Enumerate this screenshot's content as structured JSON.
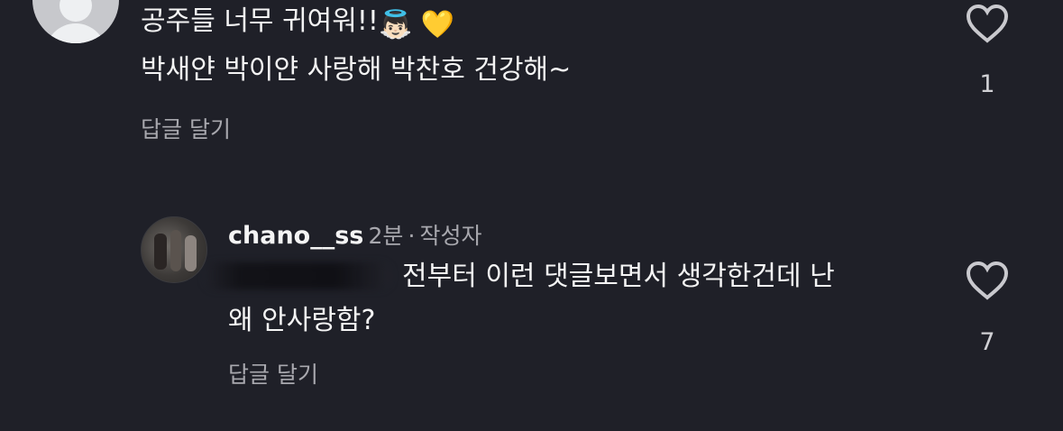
{
  "comment1": {
    "line1": "공주들 너무 귀여워!!",
    "emojis": [
      "👼🏻",
      "💛"
    ],
    "line2": "박새얀 박이얀 사랑해 박찬호 건강해~",
    "reply_label": "답글 달기",
    "like_count": "1"
  },
  "reply1": {
    "username": "chano__ss",
    "time": "2분",
    "separator": "·",
    "role": "작성자",
    "line1": "전부터 이런 댓글보면서 생각한건데 난",
    "line2": "왜 안사랑함?",
    "reply_label": "답글 달기",
    "like_count": "7"
  }
}
